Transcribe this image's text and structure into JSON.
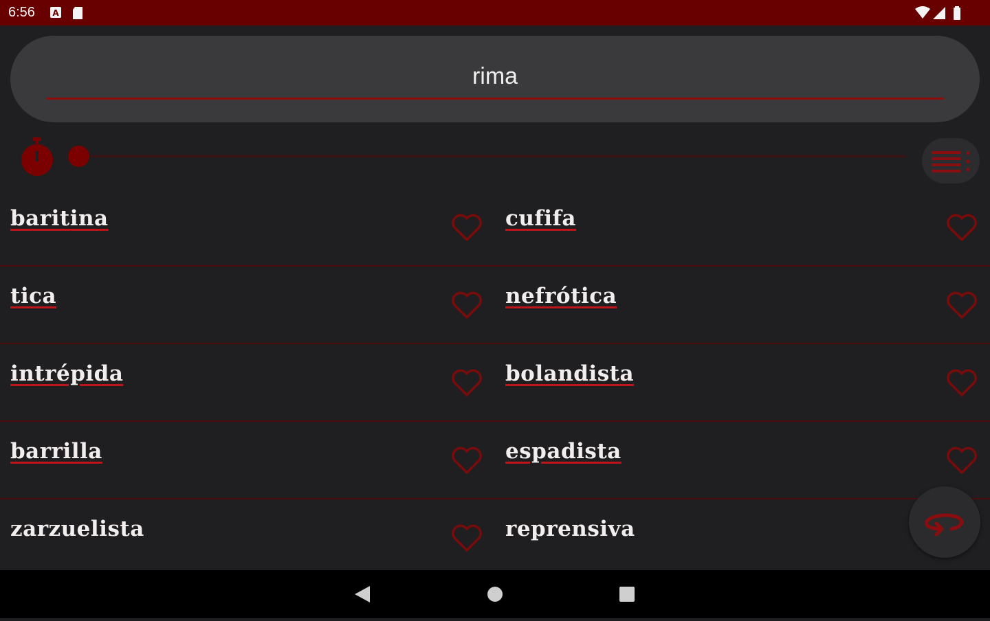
{
  "status_bar": {
    "time": "6:56"
  },
  "search": {
    "value": "rima",
    "placeholder": ""
  },
  "results": [
    {
      "word": "baritina",
      "linked": true
    },
    {
      "word": "cufifa",
      "linked": true
    },
    {
      "word": "tica",
      "linked": true
    },
    {
      "word": "nefrótica",
      "linked": true
    },
    {
      "word": "intrépida",
      "linked": true
    },
    {
      "word": "bolandista",
      "linked": true
    },
    {
      "word": "barrilla",
      "linked": true
    },
    {
      "word": "espadista",
      "linked": true
    },
    {
      "word": "zarzuelista",
      "linked": false
    },
    {
      "word": "reprensiva",
      "linked": false
    }
  ],
  "colors": {
    "accent": "#7b0000",
    "status_bar": "#680000",
    "background": "#1f1f21",
    "search_field": "#3a3a3c"
  },
  "icons": {
    "timer": "stopwatch-icon",
    "list": "list-menu-icon",
    "favorite": "heart-outline-icon",
    "fab": "loop-arrow-icon",
    "back": "back-triangle-icon",
    "home": "home-circle-icon",
    "recents": "recents-square-icon"
  }
}
